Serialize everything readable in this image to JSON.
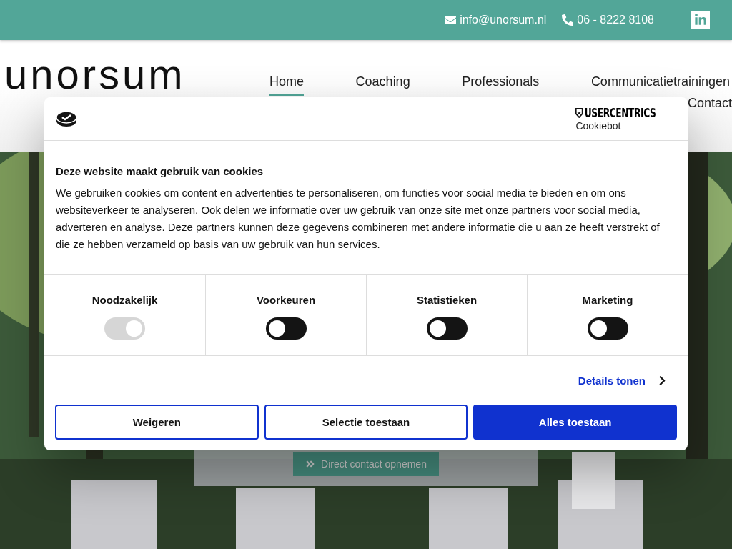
{
  "topbar": {
    "email": "info@unorsum.nl",
    "phone": "06 - 8222 8108"
  },
  "logo": "unorsum",
  "nav": [
    {
      "label": "Home",
      "selected": true
    },
    {
      "label": "Coaching",
      "selected": false
    },
    {
      "label": "Professionals",
      "selected": false
    },
    {
      "label": "Communicatietrainingen",
      "selected": false
    },
    {
      "label": "Contact",
      "selected": false
    }
  ],
  "hero": {
    "kind": "picture",
    "button": "Direct contact opnemen"
  },
  "dialog": {
    "brand": "USERCENTRICS",
    "brand_sub": "Cookiebot",
    "title": "Deze website maakt gebruik van cookies",
    "body": "We gebruiken cookies om content en advertenties te personaliseren, om functies voor social media te bieden en om ons websiteverkeer te analyseren. Ook delen we informatie over uw gebruik van onze site met onze partners voor social media, adverteren en analyse. Deze partners kunnen deze gegevens combineren met andere informatie die u aan ze heeft verstrekt of die ze hebben verzameld op basis van uw gebruik van hun services.",
    "categories": [
      {
        "label": "Noodzakelijk",
        "checked": true,
        "disabled": true
      },
      {
        "label": "Voorkeuren",
        "checked": false,
        "disabled": false
      },
      {
        "label": "Statistieken",
        "checked": false,
        "disabled": false
      },
      {
        "label": "Marketing",
        "checked": false,
        "disabled": false
      }
    ],
    "details": "Details tonen",
    "buttons": [
      {
        "label": "Weigeren",
        "kind": "outline"
      },
      {
        "label": "Selectie toestaan",
        "kind": "outline"
      },
      {
        "label": "Alles toestaan",
        "kind": "primary"
      }
    ]
  }
}
